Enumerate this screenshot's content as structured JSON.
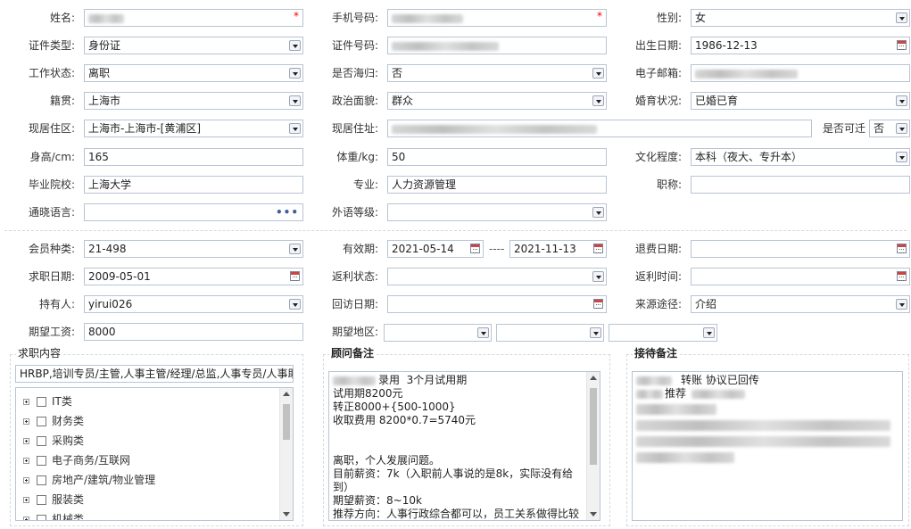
{
  "personal": {
    "name_label": "姓名:",
    "phone_label": "手机号码:",
    "gender_label": "性别:",
    "gender_value": "女",
    "id_type_label": "证件类型:",
    "id_type_value": "身份证",
    "id_number_label": "证件号码:",
    "birth_label": "出生日期:",
    "birth_value": "1986-12-13",
    "work_status_label": "工作状态:",
    "work_status_value": "离职",
    "overseas_label": "是否海归:",
    "overseas_value": "否",
    "email_label": "电子邮箱:",
    "native_label": "籍贯:",
    "native_value": "上海市",
    "political_label": "政治面貌:",
    "political_value": "群众",
    "marital_label": "婚育状况:",
    "marital_value": "已婚已育",
    "residence_area_label": "现居住区:",
    "residence_area_value": "上海市-上海市-[黄浦区]",
    "residence_addr_label": "现居住址:",
    "relocate_label": "是否可迁",
    "relocate_value": "否",
    "height_label": "身高/cm:",
    "height_value": "165",
    "weight_label": "体重/kg:",
    "weight_value": "50",
    "education_label": "文化程度:",
    "education_value": "本科（夜大、专升本）",
    "school_label": "毕业院校:",
    "school_value": "上海大学",
    "major_label": "专业:",
    "major_value": "人力资源管理",
    "title_label": "职称:",
    "language_label": "通晓语言:",
    "language_level_label": "外语等级:"
  },
  "membership": {
    "member_type_label": "会员种类:",
    "member_type_value": "21-498",
    "valid_label": "有效期:",
    "valid_from": "2021-05-14",
    "valid_sep": "----",
    "valid_to": "2021-11-13",
    "refund_date_label": "退费日期:",
    "job_date_label": "求职日期:",
    "job_date_value": "2009-05-01",
    "rebate_status_label": "返利状态:",
    "rebate_time_label": "返利时间:",
    "holder_label": "持有人:",
    "holder_value": "yirui026",
    "visit_date_label": "回访日期:",
    "source_label": "来源途径:",
    "source_value": "介绍",
    "salary_label": "期望工资:",
    "salary_value": "8000",
    "region_label": "期望地区:"
  },
  "job_panel": {
    "title": "求职内容",
    "summary": "HRBP,培训专员/主管,人事主管/经理/总监,人事专员/人事助",
    "categories": [
      "IT类",
      "财务类",
      "采购类",
      "电子商务/互联网",
      "房地产/建筑/物业管理",
      "服装类",
      "机械类"
    ]
  },
  "consultant_panel": {
    "title": "顾问备注",
    "lines": [
      "录用  3个月试用期",
      "试用期8200元",
      "转正8000+{500-1000}",
      "收取费用 8200*0.7=5740元",
      "",
      "",
      "离职，个人发展问题。",
      "目前薪资：7k（入职前人事说的是8k，实际没有给",
      "到）",
      "期望薪资：8~10k",
      "推荐方向：人事行政综合都可以，员工关系做得比较"
    ]
  },
  "reception_panel": {
    "title": "接待备注",
    "lines": [
      "转账 协议已回传",
      "推荐"
    ]
  },
  "icons": {
    "dropdown": "chevron-down-icon",
    "calendar": "calendar-icon",
    "ellipsis": "more-icon",
    "expand": "plus-icon",
    "checkbox": "checkbox-icon"
  },
  "colors": {
    "field_border": "#b8c4d4",
    "required_mark": "#e00000",
    "ellipsis": "#3a5e9e"
  }
}
